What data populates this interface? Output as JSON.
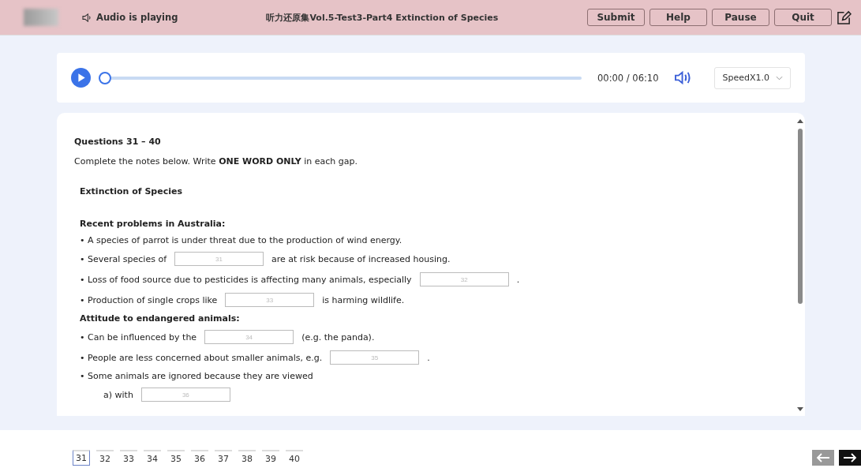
{
  "header": {
    "audio_status": "Audio is playing",
    "title": "听力还原集Vol.5-Test3-Part4 Extinction of Species",
    "buttons": [
      "Submit",
      "Help",
      "Pause",
      "Quit"
    ]
  },
  "player": {
    "level": 0,
    "time": "00:00 / 06:10",
    "speed": "SpeedX1.0"
  },
  "content": {
    "heading": "Questions 31 – 40",
    "instruction": "Complete the notes below. Write **ONE WORD ONLY** in each gap.",
    "title": "Extinction of Species",
    "lines": [
      {
        "kind": "heading",
        "text": "Recent problems in Australia:"
      },
      {
        "kind": "bullet",
        "before": "• A species of parrot is under threat due to the production of wind energy."
      },
      {
        "kind": "bullet",
        "before": "• Several species of",
        "placeholder": "31",
        "after": "are at risk because of increased housing."
      },
      {
        "kind": "bullet",
        "before": "• Loss of food source due to pesticides is affecting many animals, especially",
        "placeholder": "32",
        "after": "."
      },
      {
        "kind": "bullet",
        "before": "• Production of single crops like",
        "placeholder": "33",
        "after": "is harming wildlife."
      },
      {
        "kind": "heading",
        "text": "Attitude to endangered animals:"
      },
      {
        "kind": "bullet",
        "before": "• Can be influenced by the",
        "placeholder": "34",
        "after": "(e.g. the panda)."
      },
      {
        "kind": "bullet",
        "before": "• People are less concerned about smaller animals, e.g.",
        "placeholder": "35",
        "after": "."
      },
      {
        "kind": "bullet",
        "before": "• Some animals are ignored because they are viewed"
      },
      {
        "kind": "sub",
        "before": "a) with",
        "placeholder": "36"
      }
    ]
  },
  "nav": [
    {
      "label": "31",
      "selected": true
    },
    {
      "label": "32",
      "selected": false
    },
    {
      "label": "33",
      "selected": false
    },
    {
      "label": "34",
      "selected": false
    },
    {
      "label": "35",
      "selected": false
    },
    {
      "label": "36",
      "selected": false
    },
    {
      "label": "37",
      "selected": false
    },
    {
      "label": "38",
      "selected": false
    },
    {
      "label": "39",
      "selected": false
    },
    {
      "label": "40",
      "selected": false
    }
  ]
}
